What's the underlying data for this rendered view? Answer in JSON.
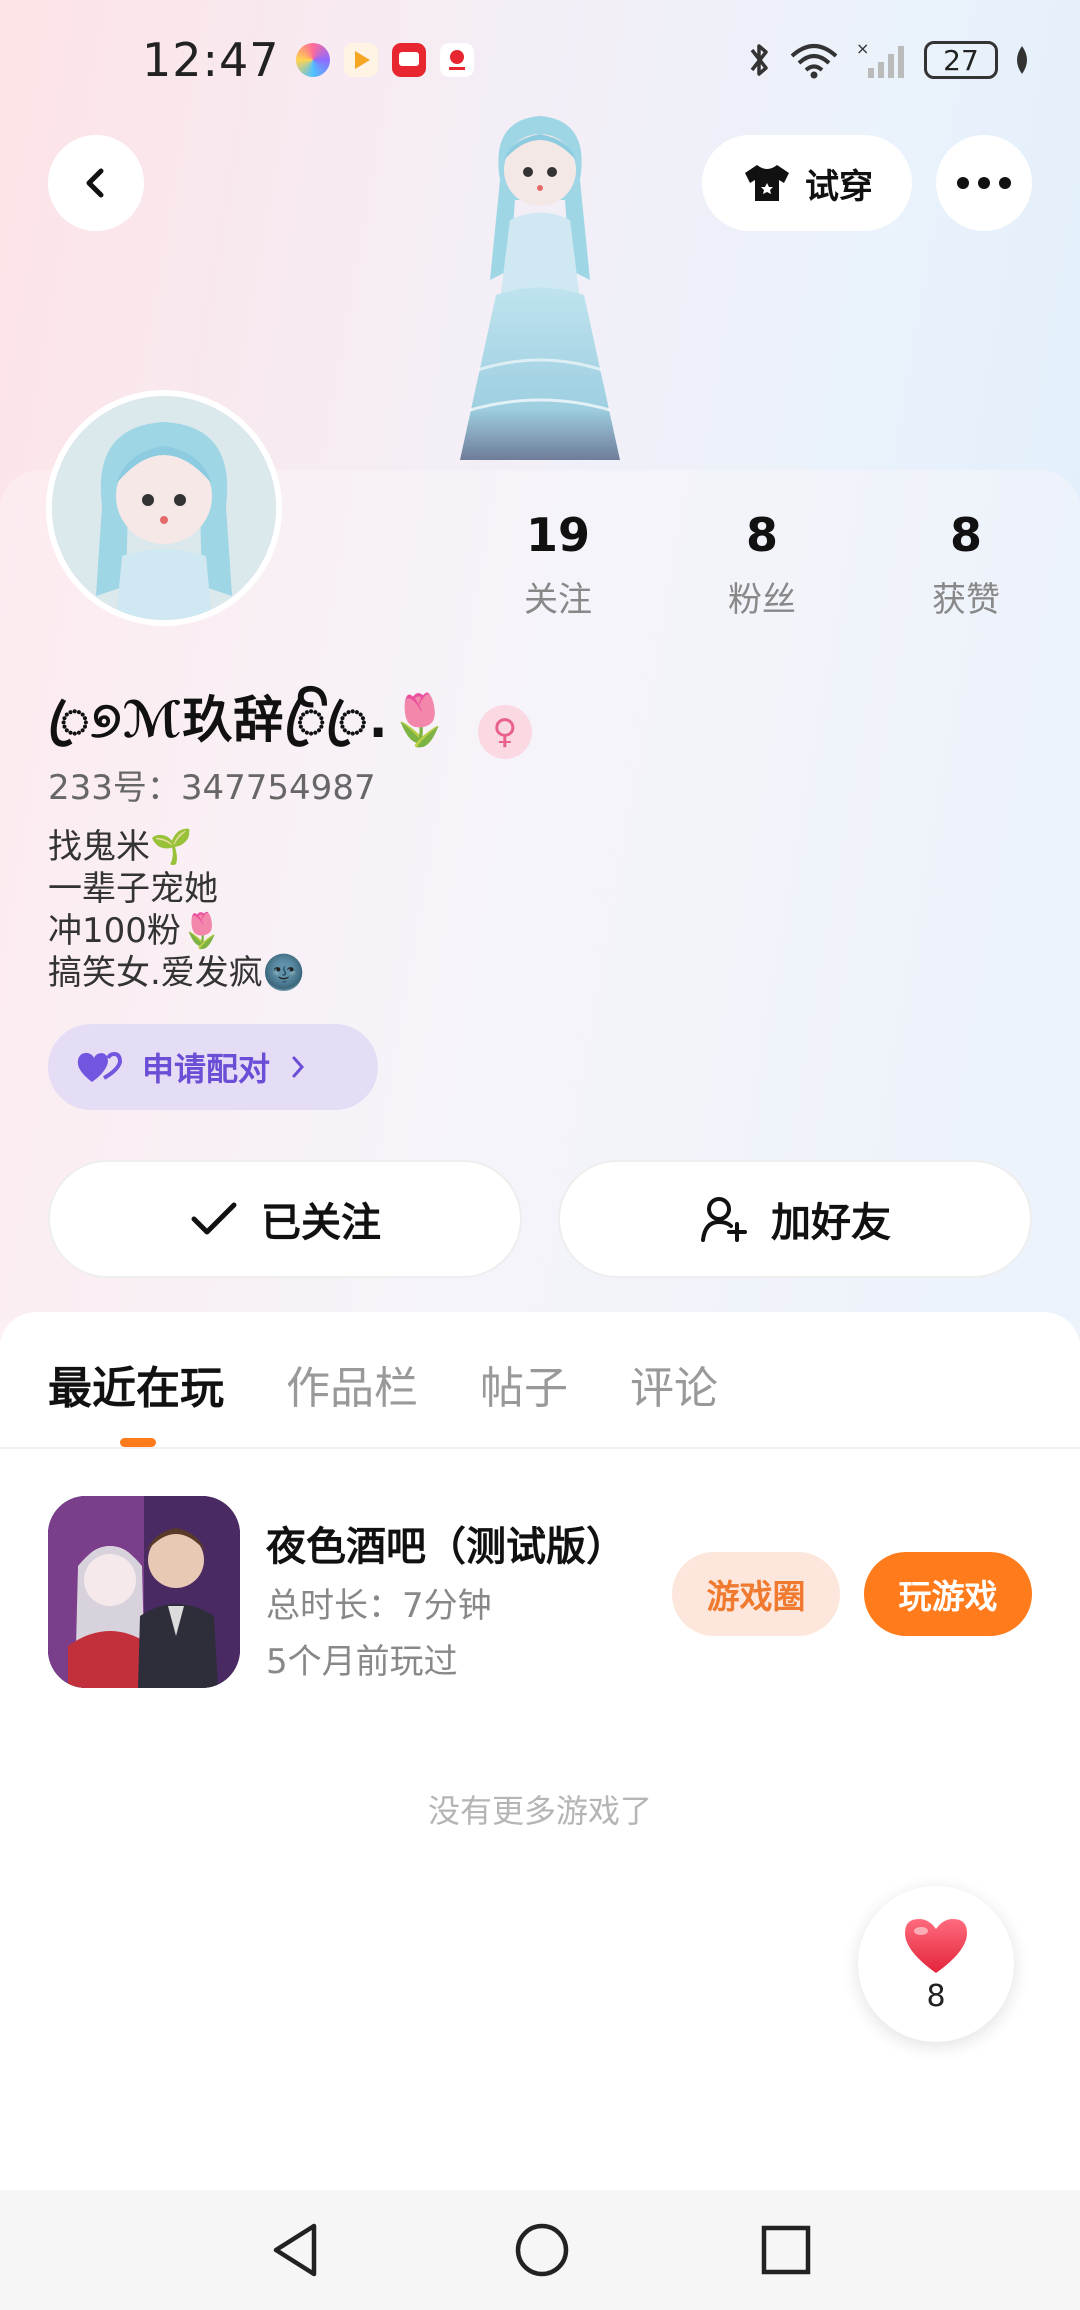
{
  "status_bar": {
    "time": "12:47",
    "battery": "27",
    "app_icons": [
      "assistant-app-icon",
      "video-app-icon",
      "tv-app-icon",
      "huawei-app-icon"
    ]
  },
  "header": {
    "try_on_label": "试穿"
  },
  "profile": {
    "nickname": "ꦿ୭ℳ玖辞ꦿꦼꦿ.🌷",
    "uid": "233号：347754987",
    "bio": [
      "找鬼米🌱",
      "一辈子宠她",
      "冲100粉🌷",
      "搞笑女.爱发疯🌚"
    ],
    "gender": "female",
    "pair_label": "申请配对",
    "stats": [
      {
        "value": "19",
        "label": "关注"
      },
      {
        "value": "8",
        "label": "粉丝"
      },
      {
        "value": "8",
        "label": "获赞"
      }
    ],
    "following_label": "已关注",
    "add_friend_label": "加好友"
  },
  "tabs": [
    {
      "label": "最近在玩",
      "active": true
    },
    {
      "label": "作品栏",
      "active": false
    },
    {
      "label": "帖子",
      "active": false
    },
    {
      "label": "评论",
      "active": false
    }
  ],
  "games": [
    {
      "title": "夜色酒吧（测试版）",
      "total_time": "总时长：7分钟",
      "last_played": "5个月前玩过",
      "circle_label": "游戏圈",
      "play_label": "玩游戏"
    }
  ],
  "empty_message": "没有更多游戏了",
  "like_fab": {
    "count": "8"
  },
  "colors": {
    "accent_orange": "#ff7b1c",
    "pair_purple": "#6a4fd6",
    "like_red": "#f0394f"
  }
}
